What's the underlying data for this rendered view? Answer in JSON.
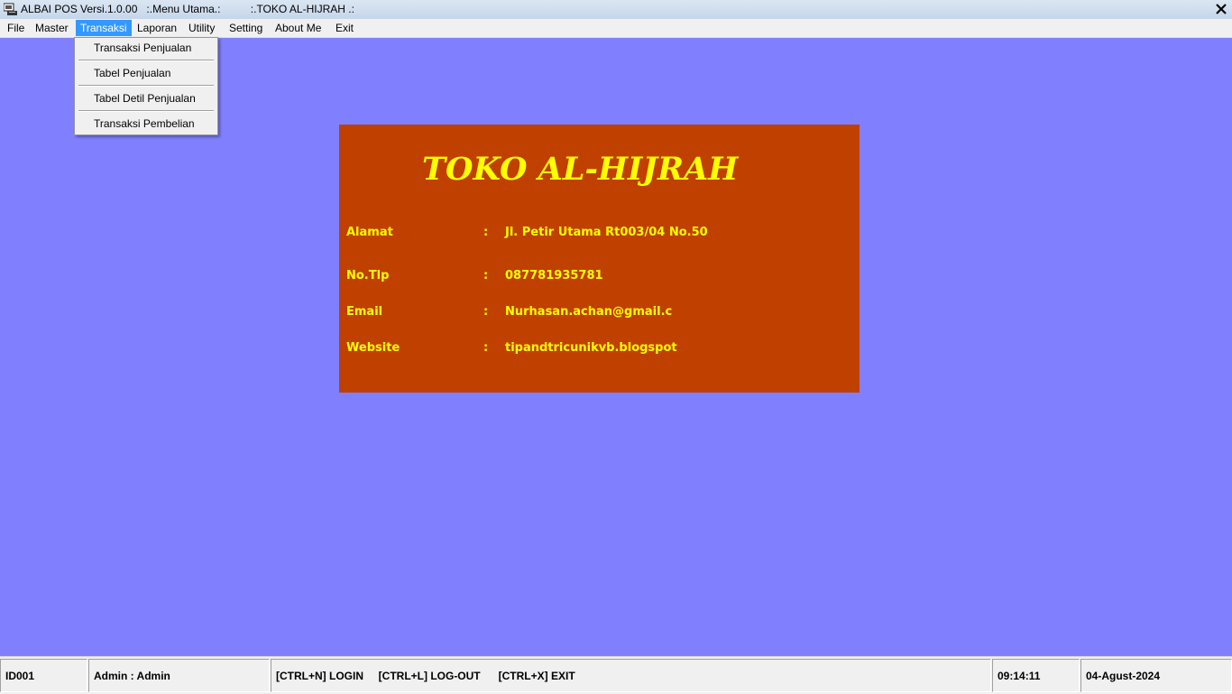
{
  "window": {
    "title": "ALBAI POS Versi.1.0.00   :.Menu Utama.:          :.TOKO AL-HIJRAH .:",
    "icon": "app-icon",
    "close_icon": "close-icon"
  },
  "menubar": {
    "items": [
      "File",
      "Master",
      "Transaksi",
      "Laporan",
      "Utility",
      "Setting",
      "About Me",
      "Exit"
    ],
    "active": "Transaksi"
  },
  "dropdown": {
    "items": [
      "Transaksi Penjualan",
      "Tabel Penjualan",
      "Tabel Detil Penjualan",
      "Transaksi Pembelian"
    ]
  },
  "store": {
    "name": "TOKO AL-HIJRAH",
    "fields": [
      {
        "label": "Alamat",
        "colon": ":",
        "value": "Jl. Petir Utama Rt003/04 No.50"
      },
      {
        "label": "No.Tlp",
        "colon": ":",
        "value": "087781935781"
      },
      {
        "label": "Email",
        "colon": ":",
        "value": "Nurhasan.achan@gmail.c"
      },
      {
        "label": "Website",
        "colon": ":",
        "value": "tipandtricunikvb.blogspot"
      }
    ]
  },
  "statusbar": {
    "id": "ID001",
    "user": "Admin : Admin",
    "shortcuts": "[CTRL+N] LOGIN     [CTRL+L] LOG-OUT      [CTRL+X] EXIT",
    "time": "09:14:11",
    "date": "04-Agust-2024"
  },
  "colors": {
    "desktop": "#8080ff",
    "panel_bg": "#c04000",
    "panel_text": "#ffff00",
    "menu_highlight": "#3399ff"
  }
}
